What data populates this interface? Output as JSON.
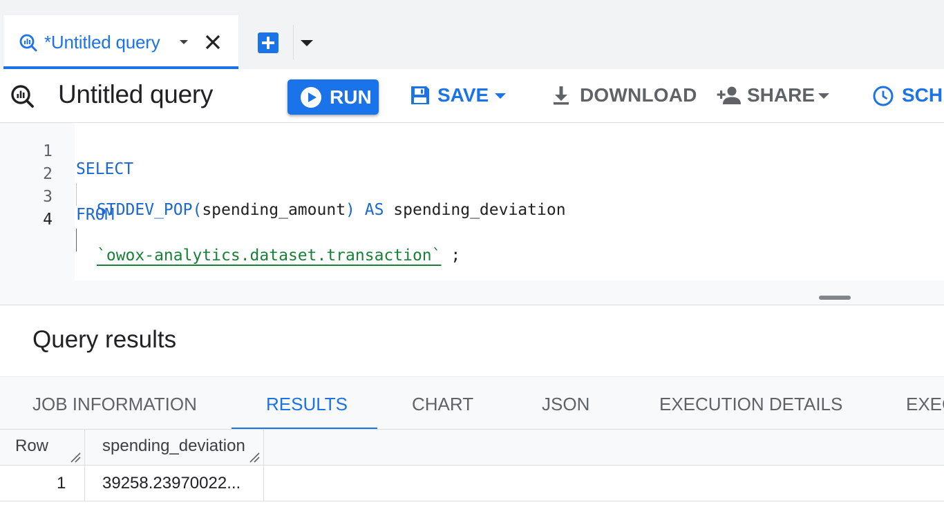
{
  "tab": {
    "label": "*Untitled query"
  },
  "toolbar": {
    "title": "Untitled query",
    "run_label": "RUN",
    "save_label": "SAVE",
    "download_label": "DOWNLOAD",
    "share_label": "SHARE",
    "schedule_label": "SCHE"
  },
  "editor": {
    "line_numbers": [
      "1",
      "2",
      "3",
      "4"
    ],
    "lines": [
      {
        "tokens": [
          "SELECT"
        ]
      },
      {
        "tokens": [
          "STDDEV_POP(",
          "spending_amount",
          ")",
          " AS ",
          "spending_deviation"
        ]
      },
      {
        "tokens": [
          "FROM"
        ]
      },
      {
        "tokens": [
          "`owox-analytics.dataset.transaction`",
          " ;"
        ]
      }
    ]
  },
  "results": {
    "title": "Query results",
    "tabs": [
      "JOB INFORMATION",
      "RESULTS",
      "CHART",
      "JSON",
      "EXECUTION DETAILS",
      "EXEC"
    ],
    "active_tab": "RESULTS",
    "columns": [
      "Row",
      "spending_deviation"
    ],
    "rows": [
      {
        "row": "1",
        "spending_deviation": "39258.23970022..."
      }
    ]
  },
  "colors": {
    "accent": "#1a73e8",
    "keyword": "#1967d2",
    "string": "#188038"
  }
}
